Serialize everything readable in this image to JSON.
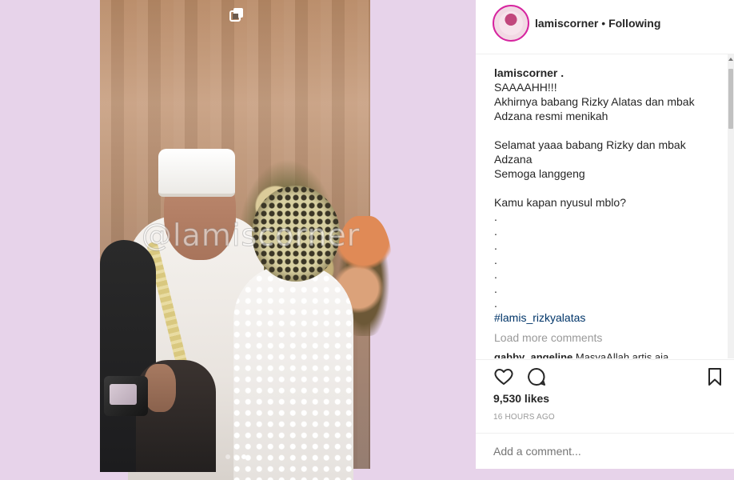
{
  "post": {
    "watermark": "@lamiscorner",
    "carousel_dots": 3,
    "carousel_active_index": 2
  },
  "header": {
    "username": "lamiscorner",
    "separator": "•",
    "follow_status": "Following"
  },
  "caption": {
    "username": "lamiscorner .",
    "lines": [
      "SAAAAHH!!!",
      "Akhirnya babang Rizky Alatas dan mbak",
      "Adzana resmi menikah",
      "",
      "Selamat yaaa babang Rizky dan mbak",
      "Adzana",
      "Semoga langgeng",
      "",
      "Kamu kapan nyusul mblo?",
      ".",
      ".",
      ".",
      ".",
      ".",
      ".",
      "."
    ],
    "hashtag": "#lamis_rizkyalatas"
  },
  "comments": {
    "load_more": "Load more comments",
    "next_comment_user": "gabby_angeline",
    "next_comment_text": "MasyaAllah artis aja"
  },
  "actions": {
    "like_icon": "heart-icon",
    "comment_icon": "comment-icon",
    "save_icon": "bookmark-icon"
  },
  "likes": "9,530 likes",
  "time": "16 HOURS AGO",
  "comment_input": {
    "placeholder": "Add a comment..."
  },
  "colors": {
    "background": "#e7d3ea",
    "text": "#262626",
    "muted": "#999999",
    "hashtag": "#003569"
  }
}
